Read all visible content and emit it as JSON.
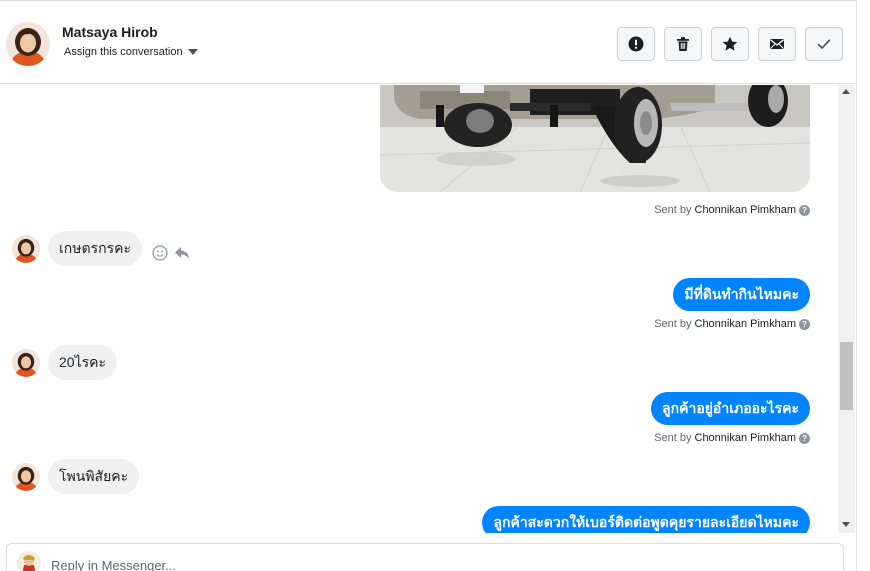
{
  "header": {
    "contact_name": "Matsaya Hirob",
    "assign_label": "Assign this conversation",
    "actions": [
      {
        "name": "spam-button",
        "icon": "exclamation-icon"
      },
      {
        "name": "delete-button",
        "icon": "trash-icon"
      },
      {
        "name": "star-button",
        "icon": "star-icon"
      },
      {
        "name": "mark-unread-button",
        "icon": "envelope-icon"
      },
      {
        "name": "mark-done-button",
        "icon": "checkmark-icon"
      }
    ]
  },
  "conversation": {
    "sent_by_prefix": "Sent by",
    "agent_name": "Chonnikan Pimkham",
    "help_glyph": "?",
    "messages": [
      {
        "direction": "out",
        "type": "image",
        "icon": "car-photo"
      },
      {
        "direction": "in",
        "text": "เกษตรกรคะ"
      },
      {
        "direction": "out",
        "text": "มีที่ดินทำกินไหมคะ"
      },
      {
        "direction": "in",
        "text": "20ไรคะ"
      },
      {
        "direction": "out",
        "text": "ลูกค้าอยู่อำเภออะไรคะ"
      },
      {
        "direction": "in",
        "text": "โพนพิสัยคะ"
      },
      {
        "direction": "out",
        "text": "ลูกค้าสะดวกให้เบอร์ติดต่อพูดคุยรายละเอียดไหมคะ"
      }
    ]
  },
  "reply": {
    "placeholder": "Reply in Messenger..."
  },
  "colors": {
    "outgoing_bubble": "#0084ff",
    "incoming_bubble": "#f0f0f0",
    "border": "#dadde1"
  }
}
